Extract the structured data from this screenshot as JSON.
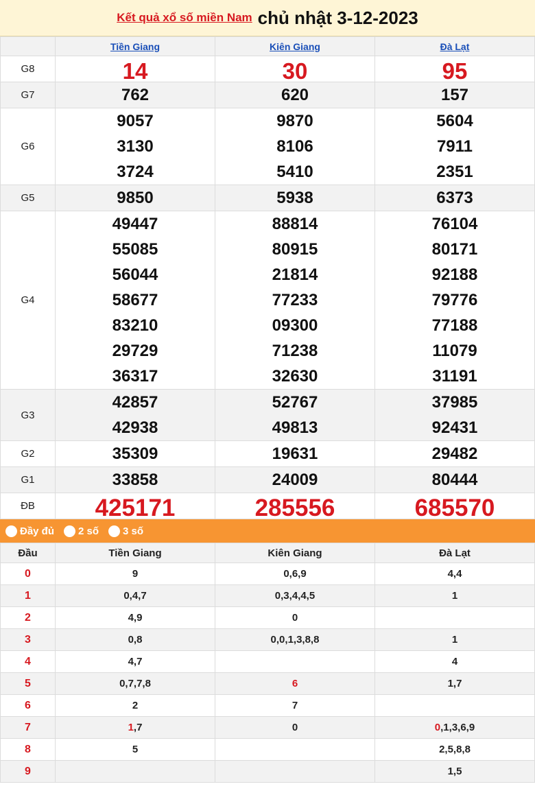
{
  "header": {
    "title_link": "Kết quả xổ số miền Nam",
    "title_date": "chủ nhật 3-12-2023"
  },
  "provinces": [
    "Tiền Giang",
    "Kiên Giang",
    "Đà Lạt"
  ],
  "prizes": [
    {
      "label": "G8",
      "values": [
        [
          "14"
        ],
        [
          "30"
        ],
        [
          "95"
        ]
      ]
    },
    {
      "label": "G7",
      "values": [
        [
          "762"
        ],
        [
          "620"
        ],
        [
          "157"
        ]
      ]
    },
    {
      "label": "G6",
      "values": [
        [
          "9057",
          "3130",
          "3724"
        ],
        [
          "9870",
          "8106",
          "5410"
        ],
        [
          "5604",
          "7911",
          "2351"
        ]
      ]
    },
    {
      "label": "G5",
      "values": [
        [
          "9850"
        ],
        [
          "5938"
        ],
        [
          "6373"
        ]
      ]
    },
    {
      "label": "G4",
      "values": [
        [
          "49447",
          "55085",
          "56044",
          "58677",
          "83210",
          "29729",
          "36317"
        ],
        [
          "88814",
          "80915",
          "21814",
          "77233",
          "09300",
          "71238",
          "32630"
        ],
        [
          "76104",
          "80171",
          "92188",
          "79776",
          "77188",
          "11079",
          "31191"
        ]
      ]
    },
    {
      "label": "G3",
      "values": [
        [
          "42857",
          "42938"
        ],
        [
          "52767",
          "49813"
        ],
        [
          "37985",
          "92431"
        ]
      ]
    },
    {
      "label": "G2",
      "values": [
        [
          "35309"
        ],
        [
          "19631"
        ],
        [
          "29482"
        ]
      ]
    },
    {
      "label": "G1",
      "values": [
        [
          "33858"
        ],
        [
          "24009"
        ],
        [
          "80444"
        ]
      ]
    },
    {
      "label": "ĐB",
      "values": [
        [
          "425171"
        ],
        [
          "285556"
        ],
        [
          "685570"
        ]
      ]
    }
  ],
  "tabs": {
    "full": "Đầy đủ",
    "two": "2 số",
    "three": "3 số"
  },
  "loto": {
    "head_label": "Đầu",
    "rows": [
      {
        "dau": "0",
        "cells": [
          [
            "9",
            ""
          ],
          [
            "0,6,9",
            ""
          ],
          [
            "4,4",
            ""
          ]
        ]
      },
      {
        "dau": "1",
        "cells": [
          [
            "0,4,7",
            ""
          ],
          [
            "0,3,4,4,5",
            ""
          ],
          [
            "1",
            ""
          ]
        ]
      },
      {
        "dau": "2",
        "cells": [
          [
            "4,9",
            ""
          ],
          [
            "0",
            ""
          ],
          [
            "",
            ""
          ]
        ]
      },
      {
        "dau": "3",
        "cells": [
          [
            "0,8",
            ""
          ],
          [
            "0,0,1,3,8,8",
            ""
          ],
          [
            "1",
            ""
          ]
        ]
      },
      {
        "dau": "4",
        "cells": [
          [
            "4,7",
            ""
          ],
          [
            "",
            ""
          ],
          [
            "4",
            ""
          ]
        ]
      },
      {
        "dau": "5",
        "cells": [
          [
            "0,7,7,8",
            ""
          ],
          [
            "",
            "6"
          ],
          [
            "1,7",
            ""
          ]
        ]
      },
      {
        "dau": "6",
        "cells": [
          [
            "2",
            ""
          ],
          [
            "7",
            ""
          ],
          [
            "",
            ""
          ]
        ]
      },
      {
        "dau": "7",
        "cells": [
          [
            ",7",
            "1"
          ],
          [
            "0",
            ""
          ],
          [
            ",1,3,6,9",
            "0"
          ]
        ]
      },
      {
        "dau": "8",
        "cells": [
          [
            "5",
            ""
          ],
          [
            "",
            ""
          ],
          [
            "2,5,8,8",
            ""
          ]
        ]
      },
      {
        "dau": "9",
        "cells": [
          [
            "",
            ""
          ],
          [
            "",
            ""
          ],
          [
            "1,5",
            ""
          ]
        ]
      }
    ]
  },
  "colors": {
    "accent_red": "#d71920",
    "link_blue": "#1a4fb8",
    "tab_orange": "#f79532",
    "title_bg": "#fef5d6"
  }
}
